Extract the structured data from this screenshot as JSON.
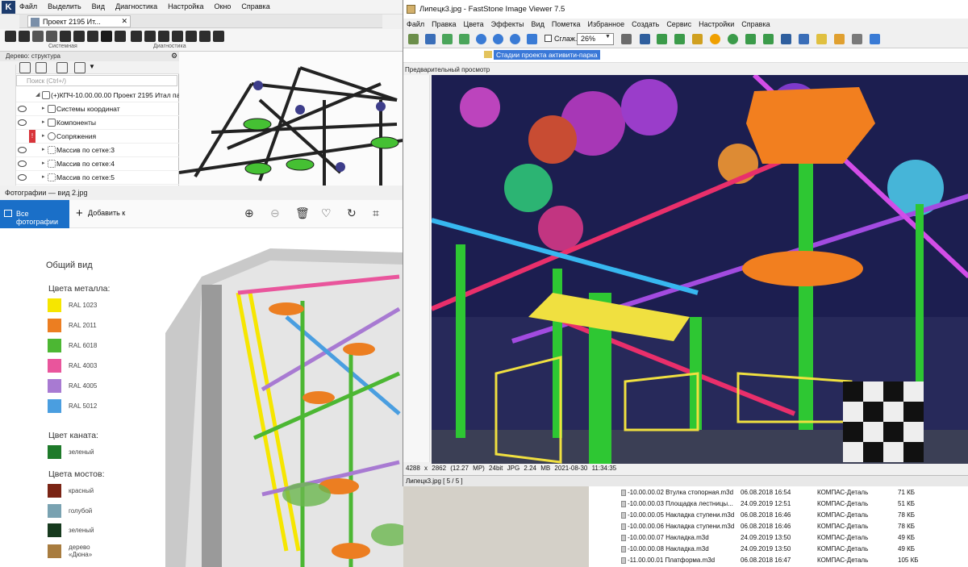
{
  "kompas": {
    "menu": [
      "Файл",
      "Выделить",
      "Вид",
      "Диагностика",
      "Настройка",
      "Окно",
      "Справка"
    ],
    "doc_tab": "Проект 2195 Ит...",
    "toolbar_groups": [
      "Системная",
      "Диагностика"
    ],
    "tree_title": "Дерево: структура",
    "search_placeholder": "Поиск (Ctrl+/)",
    "tree_items": [
      "(+)КПЧ-10.00.00.00 Проект 2195 Итал парк",
      "Системы координат",
      "Компоненты",
      "Сопряжения",
      "Массив по сетке:3",
      "Массив по сетке:4",
      "Массив по сетке:5"
    ],
    "warning_mark": "!"
  },
  "photos": {
    "title": "Фотографии — вид 2.jpg",
    "all_photos": "Все фотографии",
    "add_to": "Добавить к",
    "tools": [
      "zoom-in-icon",
      "zoom-out-icon",
      "delete-icon",
      "favorite-icon",
      "rotate-icon",
      "crop-icon"
    ],
    "legend": {
      "general": "Общий вид",
      "metal_title": "Цвета металла:",
      "metal": [
        {
          "label": "RAL 1023",
          "color": "#f6e600"
        },
        {
          "label": "RAL 2011",
          "color": "#ec7e21"
        },
        {
          "label": "RAL 6018",
          "color": "#4cb733"
        },
        {
          "label": "RAL 4003",
          "color": "#e9559c"
        },
        {
          "label": "RAL 4005",
          "color": "#a87ad2"
        },
        {
          "label": "RAL 5012",
          "color": "#4a9ee0"
        }
      ],
      "rope_title": "Цвет каната:",
      "rope": [
        {
          "label": "зеленый",
          "color": "#1e7a2a"
        }
      ],
      "bridge_title": "Цвета мостов:",
      "bridges": [
        {
          "label": "красный",
          "color": "#7a2414"
        },
        {
          "label": "голубой",
          "color": "#79a2b1"
        },
        {
          "label": "зеленый",
          "color": "#173a1e"
        },
        {
          "label": "дерево",
          "label2": "«Дюна»",
          "color": "#a87c3f"
        }
      ]
    }
  },
  "faststone": {
    "title": "Липецк3.jpg - FastStone Image Viewer 7.5",
    "menu": [
      "Файл",
      "Правка",
      "Цвета",
      "Эффекты",
      "Вид",
      "Пометка",
      "Избранное",
      "Создать",
      "Сервис",
      "Настройки",
      "Справка"
    ],
    "smooth_label": "Сглаж.",
    "zoom": "26%",
    "folder": "Стадии проекта активити-парка",
    "preview_label": "Предварительный просмотр",
    "info": "4288 x 2862 (12.27 MP)  24bit  JPG  2.24 MB  2021-08-30 11:34:35",
    "status": "Липецк3.jpg [ 5 / 5 ]"
  },
  "files": [
    {
      "name": "-10.00.00.02 Втулка стопорная.m3d",
      "date": "06.08.2018 16:54",
      "type": "КОМПАС-Деталь",
      "size": "71 КБ"
    },
    {
      "name": "-10.00.00.03 Площадка лестницы...",
      "date": "24.09.2019 12:51",
      "type": "КОМПАС-Деталь",
      "size": "51 КБ"
    },
    {
      "name": "-10.00.00.05 Накладка ступени.m3d",
      "date": "06.08.2018 16:46",
      "type": "КОМПАС-Деталь",
      "size": "78 КБ"
    },
    {
      "name": "-10.00.00.06 Накладка ступени.m3d",
      "date": "06.08.2018 16:46",
      "type": "КОМПАС-Деталь",
      "size": "78 КБ"
    },
    {
      "name": "-10.00.00.07 Накладка.m3d",
      "date": "24.09.2019 13:50",
      "type": "КОМПАС-Деталь",
      "size": "49 КБ"
    },
    {
      "name": "-10.00.00.08 Накладка.m3d",
      "date": "24.09.2019 13:50",
      "type": "КОМПАС-Деталь",
      "size": "49 КБ"
    },
    {
      "name": "-11.00.00.01 Платформа.m3d",
      "date": "06.08.2018 16:47",
      "type": "КОМПАС-Деталь",
      "size": "105 КБ"
    }
  ]
}
